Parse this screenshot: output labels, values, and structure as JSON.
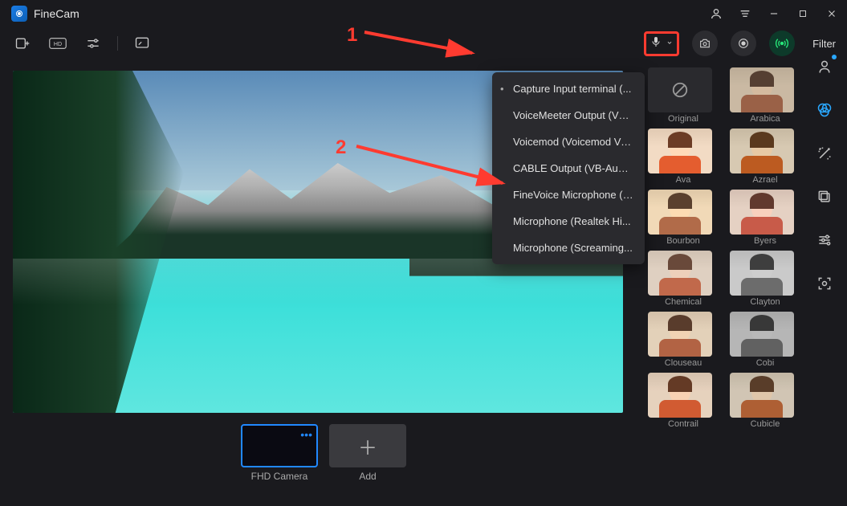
{
  "app": {
    "title": "FineCam"
  },
  "toolbar": {
    "filter_label": "Filter"
  },
  "mic_menu": {
    "items": [
      "Capture Input terminal (...",
      "VoiceMeeter Output (VB...",
      "Voicemod (Voicemod Vir...",
      "CABLE Output (VB-Audi...",
      "FineVoice Microphone (F...",
      "Microphone (Realtek Hi...",
      "Microphone (Screaming..."
    ],
    "selected_index": 0
  },
  "sources": {
    "camera_label": "FHD Camera",
    "add_label": "Add"
  },
  "filters": [
    {
      "key": "original",
      "label": "Original"
    },
    {
      "key": "arabica",
      "label": "Arabica"
    },
    {
      "key": "ava",
      "label": "Ava"
    },
    {
      "key": "azrael",
      "label": "Azrael"
    },
    {
      "key": "bourbon",
      "label": "Bourbon"
    },
    {
      "key": "byers",
      "label": "Byers"
    },
    {
      "key": "chemical",
      "label": "Chemical"
    },
    {
      "key": "clayton",
      "label": "Clayton"
    },
    {
      "key": "clouseau",
      "label": "Clouseau"
    },
    {
      "key": "cobi",
      "label": "Cobi"
    },
    {
      "key": "contrail",
      "label": "Contrail"
    },
    {
      "key": "cubicle",
      "label": "Cubicle"
    }
  ],
  "annotations": {
    "step1": "1",
    "step2": "2"
  }
}
